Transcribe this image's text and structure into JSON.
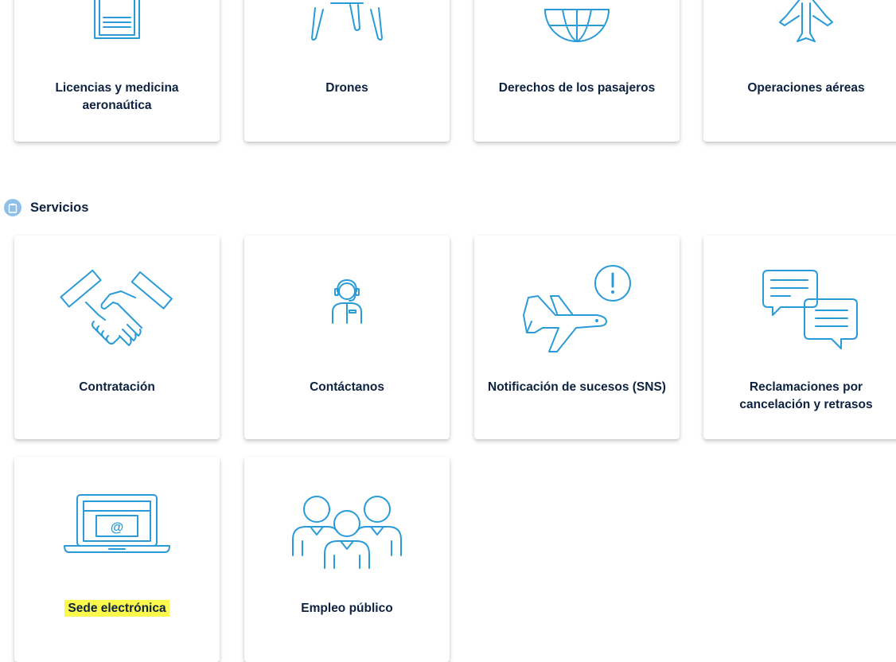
{
  "top_cards": [
    {
      "label": "Licencias y medicina aeronaútica",
      "icon": "document-icon"
    },
    {
      "label": "Drones",
      "icon": "drone-icon"
    },
    {
      "label": "Derechos de los pasajeros",
      "icon": "globe-icon"
    },
    {
      "label": "Operaciones aéreas",
      "icon": "airplane-icon"
    }
  ],
  "section": {
    "title": "Servicios",
    "icon": "clipboard-icon"
  },
  "service_cards": [
    {
      "label": "Contratación",
      "icon": "handshake-icon"
    },
    {
      "label": "Contáctanos",
      "icon": "headset-operator-icon"
    },
    {
      "label": "Notificación de sucesos (SNS)",
      "icon": "airplane-alert-icon"
    },
    {
      "label": "Reclamaciones por cancelación y retrasos",
      "icon": "chat-bubbles-icon"
    },
    {
      "label": "Sede electrónica",
      "icon": "laptop-email-icon",
      "highlighted": true
    },
    {
      "label": "Empleo público",
      "icon": "people-group-icon"
    }
  ],
  "colors": {
    "icon_stroke": "#2b9bd8",
    "text": "#0d2240",
    "badge": "#8ec0ea",
    "highlight": "#fbf94b"
  }
}
